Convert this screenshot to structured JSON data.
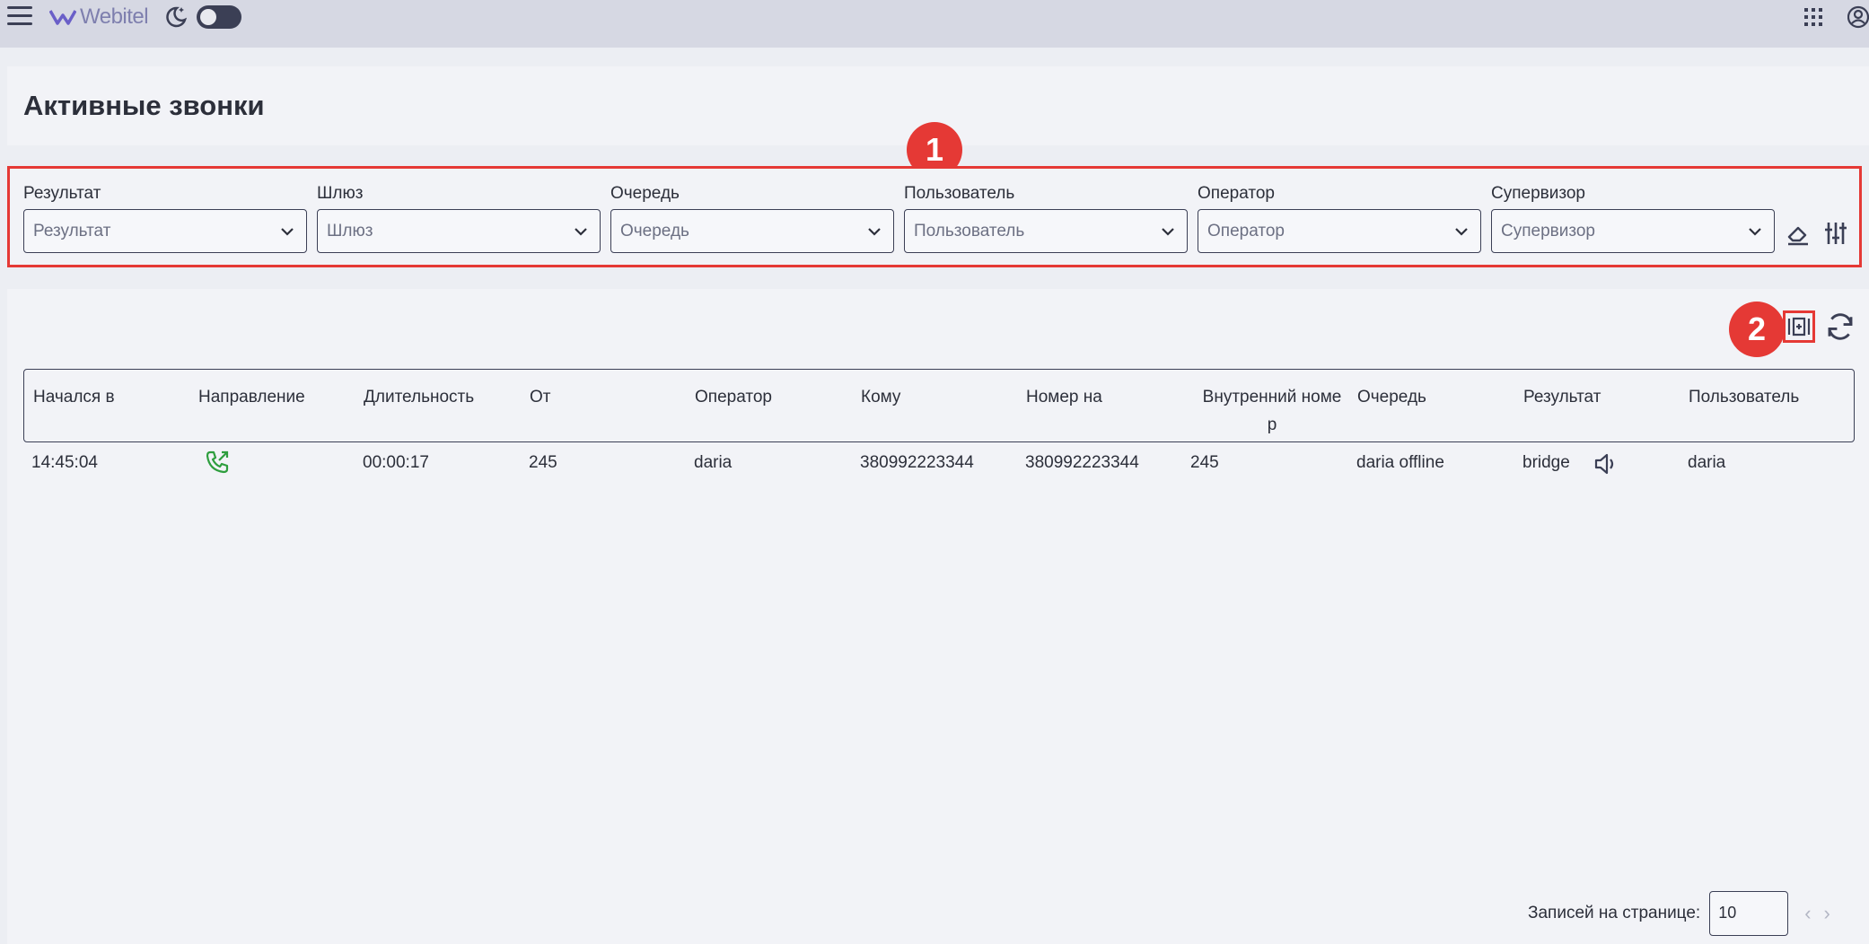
{
  "topbar": {
    "app_name": "Webitel",
    "icons": [
      "menu-icon",
      "moon-icon",
      "apps-grid-icon",
      "profile-icon"
    ]
  },
  "page": {
    "title": "Активные звонки"
  },
  "filters": [
    {
      "label": "Результат",
      "placeholder": "Результат"
    },
    {
      "label": "Шлюз",
      "placeholder": "Шлюз"
    },
    {
      "label": "Очередь",
      "placeholder": "Очередь"
    },
    {
      "label": "Пользователь",
      "placeholder": "Пользователь"
    },
    {
      "label": "Оператор",
      "placeholder": "Оператор"
    },
    {
      "label": "Супервизор",
      "placeholder": "Супервизор"
    }
  ],
  "annotations": {
    "badge1": "1",
    "badge2": "2"
  },
  "table": {
    "headers": [
      "Начался в",
      "Направление",
      "Длительность",
      "От",
      "Оператор",
      "Кому",
      "Номер на",
      "Внутренний номе\nр",
      "Очередь",
      "Результат",
      "Пользователь"
    ],
    "rows": [
      {
        "started": "14:45:04",
        "direction_icon": "outbound-call-icon",
        "duration": "00:00:17",
        "from": "245",
        "operator": "daria",
        "to": "380992223344",
        "number_on": "380992223344",
        "internal": "245",
        "queue": "daria offline",
        "result": "bridge",
        "user": "daria"
      }
    ]
  },
  "pagination": {
    "label": "Записей на странице:",
    "per_page": "10"
  },
  "colors": {
    "accent_red": "#e53935",
    "call_green": "#2e9e3e",
    "dark": "#3b3f55"
  }
}
